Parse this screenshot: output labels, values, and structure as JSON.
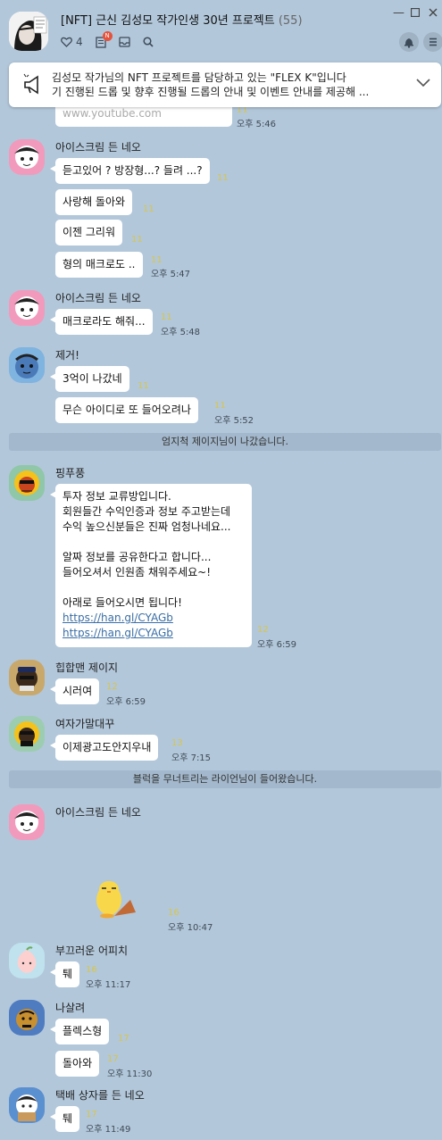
{
  "header": {
    "title": "[NFT] 근신 김성모 작가인생 30년 프로젝트",
    "member_count": "(55)",
    "like_count": "4",
    "menu_badge": "N"
  },
  "notice": {
    "line1": "김성모 작가님의 NFT 프로젝트를 담당하고 있는 \"FLEX K\"입니다",
    "line2": "기 진행된 드롭 및 향후 진행될 드롭의 안내 및 이벤트 안내를 제공해 ..."
  },
  "top_partial": {
    "text": "www.youtube.com",
    "unread": "11",
    "time": "오후 5:46"
  },
  "messages": [
    {
      "name": "아이스크림 든 네오",
      "bubbles": [
        {
          "text": "듣고있어 ? 방장형...? 들려 ...?",
          "unread": "11"
        },
        {
          "text": "사랑해 돌아와",
          "unread": "11"
        },
        {
          "text": "이젠 그리워",
          "unread": "11"
        },
        {
          "text": "형의 매크로도 ..",
          "unread": "11",
          "time": "오후 5:47"
        }
      ]
    },
    {
      "name": "아이스크림 든 네오",
      "bubbles": [
        {
          "text": "매크로라도 해줘...",
          "unread": "11",
          "time": "오후 5:48"
        }
      ]
    },
    {
      "name": "제거!",
      "bubbles": [
        {
          "text": "3억이 나갔네",
          "unread": "11"
        },
        {
          "text": "무슨 아이디로 또 들어오려나",
          "unread": "11",
          "time": "오후 5:52"
        }
      ]
    },
    {
      "name": "핑푸풍",
      "bubbles": [
        {
          "lines": [
            "투자 정보 교류방입니다.",
            "회원들간 수익인증과 정보 주고받는데",
            "수익 높으신분들은 진짜 엄청나네요...",
            "",
            "알짜 정보를 공유한다고 합니다...",
            "들어오셔서 인원좀 채워주세요~!",
            "",
            "아래로 들어오시면 됩니다!",
            "https://han.gl/CYAGb",
            "https://han.gl/CYAGb"
          ],
          "unread": "12",
          "time": "오후 6:59"
        }
      ]
    },
    {
      "name": "힙합맨 제이지",
      "bubbles": [
        {
          "text": "시러여",
          "unread": "12",
          "time": "오후 6:59"
        }
      ]
    },
    {
      "name": "여자가말대꾸",
      "bubbles": [
        {
          "text": "이제광고도안지우내",
          "unread": "13",
          "time": "오후 7:15"
        }
      ]
    },
    {
      "name": "아이스크림 든 네오",
      "bubbles": [
        {
          "unread": "16",
          "time": "오후 10:47"
        }
      ]
    },
    {
      "name": "부끄러운 어피치",
      "bubbles": [
        {
          "text": "퉤",
          "unread": "16",
          "time": "오후 11:17"
        }
      ]
    },
    {
      "name": "나살려",
      "bubbles": [
        {
          "text": "플렉스형",
          "unread": "17"
        },
        {
          "text": "돌아와",
          "unread": "17",
          "time": "오후 11:30"
        }
      ]
    },
    {
      "name": "택배 상자를 든 네오",
      "bubbles": [
        {
          "text": "퉤",
          "unread": "17",
          "time": "오후 11:49"
        }
      ]
    }
  ],
  "system": [
    "엄지척 제이지님이 나갔습니다.",
    "블럭을 무너트리는 라이언님이 들어왔습니다."
  ]
}
